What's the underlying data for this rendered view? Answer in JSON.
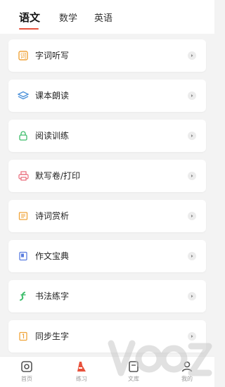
{
  "tabs": [
    {
      "label": "语文",
      "active": true
    },
    {
      "label": "数学",
      "active": false
    },
    {
      "label": "英语",
      "active": false
    }
  ],
  "items": [
    {
      "label": "字词听写",
      "icon": "word-dictation-icon",
      "color": "#f0a43a"
    },
    {
      "label": "课本朗读",
      "icon": "textbook-reading-icon",
      "color": "#4a90d9"
    },
    {
      "label": "阅读训练",
      "icon": "reading-training-icon",
      "color": "#3ebd6b"
    },
    {
      "label": "默写卷/打印",
      "icon": "printer-icon",
      "color": "#e86a7a"
    },
    {
      "label": "诗词赏析",
      "icon": "poetry-icon",
      "color": "#f0a43a"
    },
    {
      "label": "作文宝典",
      "icon": "essay-book-icon",
      "color": "#5a7de0"
    },
    {
      "label": "书法练字",
      "icon": "calligraphy-icon",
      "color": "#3ebd6b"
    },
    {
      "label": "同步生字",
      "icon": "new-characters-icon",
      "color": "#f0a43a"
    }
  ],
  "bottom_nav": [
    {
      "label": "首页",
      "icon": "home-icon",
      "active": false
    },
    {
      "label": "练习",
      "icon": "practice-icon",
      "active": true
    },
    {
      "label": "文库",
      "icon": "library-icon",
      "active": false
    },
    {
      "label": "我的",
      "icon": "profile-icon",
      "active": false
    }
  ],
  "watermark": {
    "text": "VOOZ",
    "logo": "voz-watermark"
  },
  "colors": {
    "accent": "#e8523c",
    "background": "#f3f3f3"
  }
}
